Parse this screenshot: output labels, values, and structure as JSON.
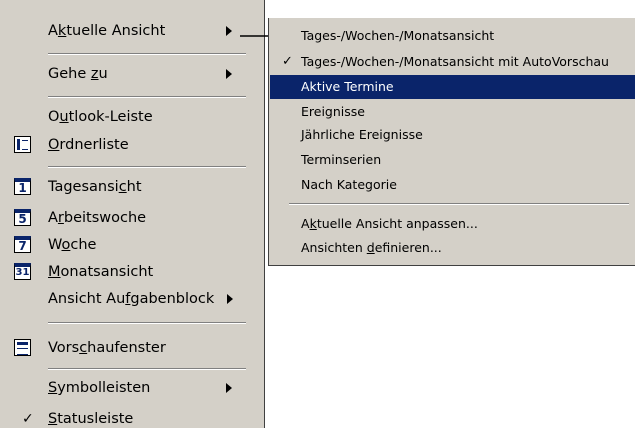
{
  "main_menu": {
    "items": [
      {
        "pre": "A",
        "key": "k",
        "post": "tuelle Ansicht"
      },
      {
        "pre": "Gehe ",
        "key": "z",
        "post": "u"
      },
      {
        "pre": "O",
        "key": "u",
        "post": "tlook-Leiste"
      },
      {
        "pre": "",
        "key": "O",
        "post": "rdnerliste"
      },
      {
        "pre": "Tagesansi",
        "key": "c",
        "post": "ht",
        "icon_text": "1"
      },
      {
        "pre": "A",
        "key": "r",
        "post": "beitswoche",
        "icon_text": "5"
      },
      {
        "pre": "W",
        "key": "o",
        "post": "che",
        "icon_text": "7"
      },
      {
        "pre": "",
        "key": "M",
        "post": "onatsansicht",
        "icon_text": "31"
      },
      {
        "pre": "Ansicht Au",
        "key": "f",
        "post": "gabenblock"
      },
      {
        "pre": "Vors",
        "key": "c",
        "post": "haufenster"
      },
      {
        "pre": "",
        "key": "S",
        "post": "ymbolleisten"
      },
      {
        "pre": "",
        "key": "S",
        "post": "tatusleiste",
        "check": "✓"
      }
    ]
  },
  "sub_menu": {
    "items": [
      {
        "pre": "Tages-/Wochen-/Monatsansicht",
        "key": "",
        "post": ""
      },
      {
        "pre": "Tages-/Wochen-/Monatsansicht mit AutoVorschau",
        "key": "",
        "post": "",
        "check": "✓"
      },
      {
        "pre": "Aktive Termine",
        "key": "",
        "post": ""
      },
      {
        "pre": "Ereignisse",
        "key": "",
        "post": ""
      },
      {
        "pre": "Jährliche Ereignisse",
        "key": "",
        "post": ""
      },
      {
        "pre": "Terminserien",
        "key": "",
        "post": ""
      },
      {
        "pre": "Nach Kategorie",
        "key": "",
        "post": ""
      },
      {
        "pre": "A",
        "key": "k",
        "post": "tuelle Ansicht anpassen..."
      },
      {
        "pre": "Ansichten ",
        "key": "d",
        "post": "efinieren..."
      }
    ],
    "highlighted_item": "Aktive Termine"
  },
  "colors": {
    "menu_background": "#d4d0c8",
    "highlight": "#0a246a",
    "highlight_text": "#ffffff"
  },
  "icons": {
    "connector": "arrow-right-icon",
    "submenu_indicator": "submenu-arrow-icon"
  }
}
